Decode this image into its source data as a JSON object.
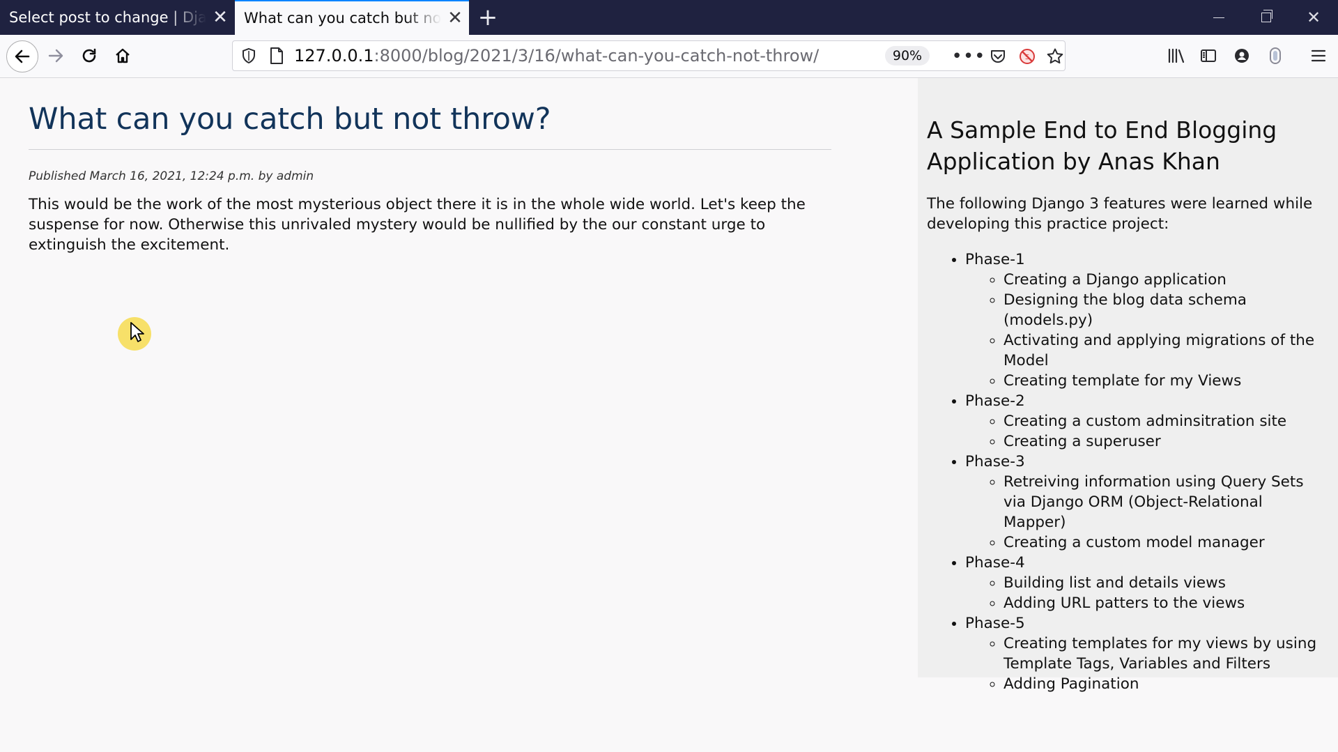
{
  "tabs": [
    {
      "title": "Select post to change | Django site admin",
      "active": false
    },
    {
      "title": "What can you catch but not throw?",
      "active": true
    }
  ],
  "navbar": {
    "url_host": "127.0.0.1",
    "url_rest": ":8000/blog/2021/3/16/what-can-you-catch-not-throw/",
    "zoom": "90%"
  },
  "post": {
    "title": "What can you catch but not throw?",
    "meta": "Published March 16, 2021, 12:24 p.m. by admin",
    "body": "This would be the work of the most mysterious object there it is in the whole wide world. Let's keep the suspense for now. Otherwise this unrivaled mystery would be nullified by the our constant urge to extinguish the excitement."
  },
  "sidebar": {
    "title": "A Sample End to End Blogging Application by Anas Khan",
    "intro": "The following Django 3 features were learned while developing this practice project:",
    "phases": [
      {
        "label": "Phase-1",
        "items": [
          "Creating a Django application",
          "Designing the blog data schema (models.py)",
          "Activating and applying migrations of the Model",
          "Creating template for my Views"
        ]
      },
      {
        "label": "Phase-2",
        "items": [
          "Creating a custom adminsitration site",
          "Creating a superuser"
        ]
      },
      {
        "label": "Phase-3",
        "items": [
          "Retreiving information using Query Sets via Django ORM (Object-Relational Mapper)",
          "Creating a custom model manager"
        ]
      },
      {
        "label": "Phase-4",
        "items": [
          "Building list and details views",
          "Adding URL patters to the views"
        ]
      },
      {
        "label": "Phase-5",
        "items": [
          "Creating templates for my views by using Template Tags, Variables and Filters",
          "Adding Pagination"
        ]
      }
    ]
  },
  "icons": {
    "tab_close": "close-icon",
    "new_tab": "plus-icon",
    "back": "arrow-left-icon",
    "forward": "arrow-right-icon",
    "reload": "reload-icon",
    "home": "home-icon",
    "tracking": "shield-icon",
    "page": "page-icon",
    "more": "more-icon",
    "pocket": "pocket-icon",
    "noscript": "noscript-icon",
    "bookmark": "star-icon",
    "library": "library-icon",
    "sidebar": "sidebar-icon",
    "account": "account-icon",
    "extension": "extension-icon",
    "menu": "hamburger-menu-icon"
  },
  "colors": {
    "tabstrip": "#1f2240",
    "title": "#12345a",
    "sidebar_bg": "#efefef",
    "accent": "#0a84ff"
  }
}
